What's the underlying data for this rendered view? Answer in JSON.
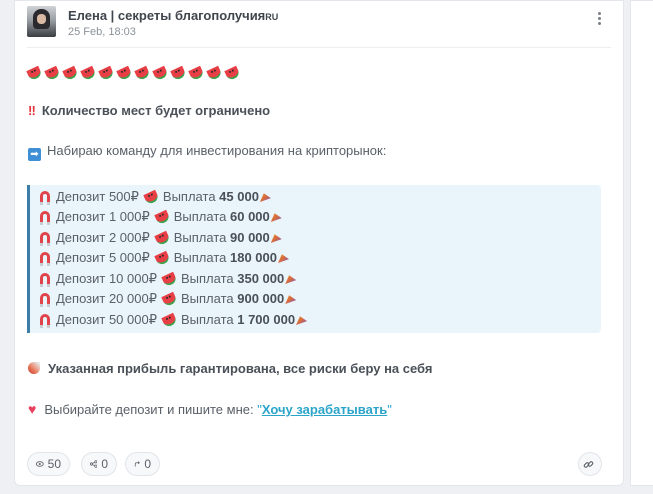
{
  "post": {
    "author": "Елена | секреты благополучия",
    "author_suffix": "RU",
    "date": "25 Feb, 18:03",
    "melon_count": 12,
    "headline": "Количество мест будет ограничено",
    "intro": "Набираю команду для инвестирования на крипторынок:",
    "offers": [
      {
        "deposit": "Депозит 500₽",
        "payout_label": "Выплата",
        "payout": "45 000"
      },
      {
        "deposit": "Депозит 1 000₽",
        "payout_label": "Выплата",
        "payout": "60 000"
      },
      {
        "deposit": "Депозит 2 000₽",
        "payout_label": "Выплата",
        "payout": "90 000"
      },
      {
        "deposit": "Депозит 5 000₽",
        "payout_label": "Выплата",
        "payout": "180 000"
      },
      {
        "deposit": "Депозит 10 000₽",
        "payout_label": "Выплата",
        "payout": "350 000"
      },
      {
        "deposit": "Депозит 20 000₽",
        "payout_label": "Выплата",
        "payout": "900 000"
      },
      {
        "deposit": "Депозит 50 000₽",
        "payout_label": "Выплата",
        "payout": "1 700 000"
      }
    ],
    "guarantee": "Указанная прибыль гарантирована, все риски беру на себя",
    "cta_prefix": "Выбирайте депозит и пишите мне: ",
    "cta_quote_open": "\"",
    "cta_link": "Хочу зарабатывать",
    "cta_quote_close": "\""
  },
  "footer": {
    "views": "50",
    "shares": "0",
    "reposts": "0"
  },
  "icons": {
    "menu": "kebab-menu-icon",
    "views": "eye-icon",
    "shares": "share-icon",
    "reposts": "repost-icon",
    "link": "link-icon",
    "bullet": "magnet-icon",
    "payout": "party-popper-icon"
  },
  "colors": {
    "accent_link": "#2aa4c9",
    "quote_bg": "#eaf4fb",
    "quote_border": "#3d7ea8"
  }
}
